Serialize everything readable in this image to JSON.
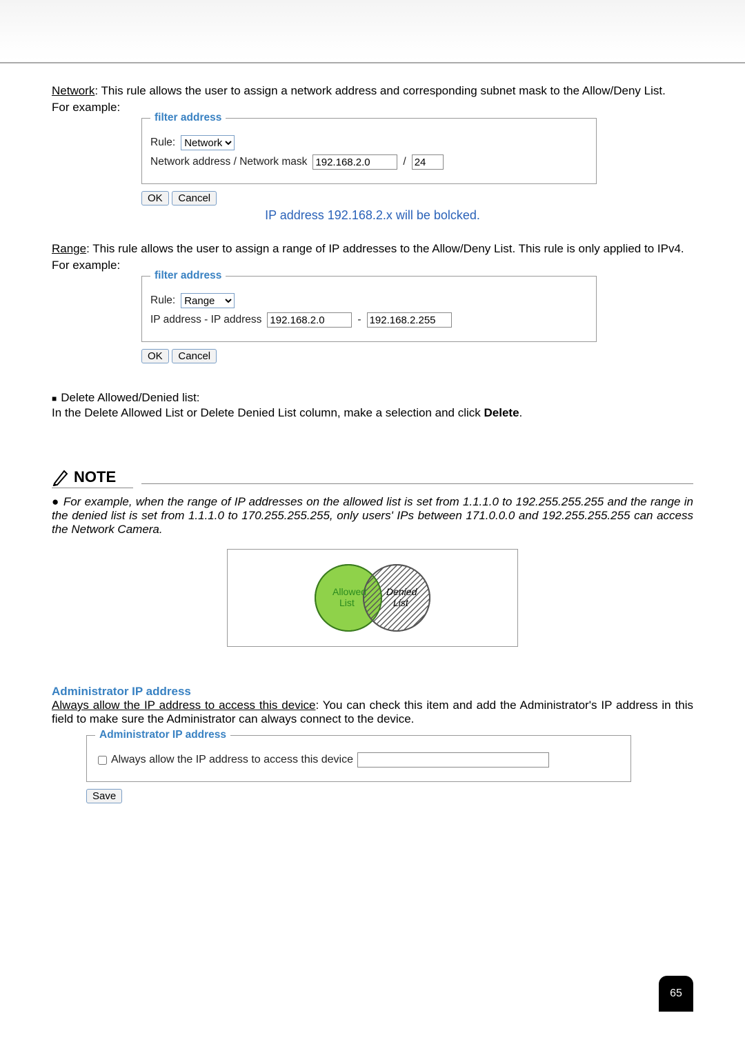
{
  "intro": {
    "network_label": "Network",
    "network_desc": ": This rule allows the user to assign a network address and corresponding subnet mask to the Allow/Deny List.",
    "for_example": "For example:"
  },
  "filter1": {
    "legend": "filter address",
    "rule_label": "Rule:",
    "rule_value": "Network",
    "fields_label": "Network address / Network mask",
    "addr": "192.168.2.0",
    "sep": "/",
    "mask": "24",
    "ok": "OK",
    "cancel": "Cancel",
    "caption": "IP address 192.168.2.x will be bolcked."
  },
  "range_intro": {
    "range_label": "Range",
    "range_desc": ": This rule allows the user to assign a range of IP addresses to the Allow/Deny List. This rule is only applied to IPv4.",
    "for_example": "For example:"
  },
  "filter2": {
    "legend": "filter address",
    "rule_label": "Rule:",
    "rule_value": "Range",
    "fields_label": "IP address - IP address",
    "from": "192.168.2.0",
    "sep": "-",
    "to": "192.168.2.255",
    "ok": "OK",
    "cancel": "Cancel"
  },
  "delete_section": {
    "title": "Delete Allowed/Denied list:",
    "body_a": "In the Delete Allowed List or Delete Denied List column, make a selection and click ",
    "body_b": "Delete",
    "body_c": "."
  },
  "note": {
    "title": "NOTE",
    "body": "For example, when the range of IP addresses on the allowed list is set from 1.1.1.0 to 192.255.255.255 and the range in the denied list is set from 1.1.1.0 to 170.255.255.255, only users' IPs between 171.0.0.0 and 192.255.255.255 can access the Network Camera."
  },
  "venn": {
    "allowed_a": "Allowed",
    "allowed_b": "List",
    "denied_a": "Denied",
    "denied_b": "List"
  },
  "admin": {
    "title": "Administrator IP address",
    "desc_u": "Always allow the IP address to access this device",
    "desc_rest": ": You can check this item and add the Administrator's IP address in this field to make sure the Administrator can always connect to the device.",
    "legend": "Administrator IP address",
    "checkbox_label": "Always allow the IP address to access this device",
    "ip_value": "",
    "save": "Save"
  },
  "page_number": "65"
}
